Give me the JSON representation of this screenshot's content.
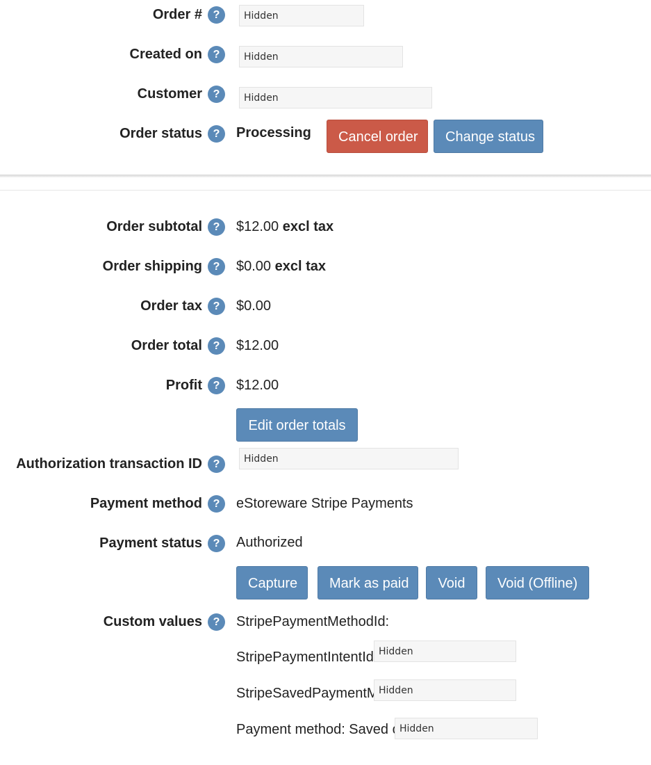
{
  "order": {
    "number_label": "Order #",
    "created_label": "Created on",
    "customer_label": "Customer",
    "status_label": "Order status",
    "status_value": "Processing",
    "cancel_button": "Cancel order",
    "change_status_button": "Change status"
  },
  "totals": {
    "subtotal_label": "Order subtotal",
    "subtotal_amount": "$12.00",
    "subtotal_suffix": "excl tax",
    "shipping_label": "Order shipping",
    "shipping_amount": "$0.00",
    "shipping_suffix": "excl tax",
    "tax_label": "Order tax",
    "tax_amount": "$0.00",
    "total_label": "Order total",
    "total_amount": "$12.00",
    "profit_label": "Profit",
    "profit_amount": "$12.00",
    "edit_button": "Edit order totals"
  },
  "payment": {
    "auth_label": "Authorization transaction ID",
    "method_label": "Payment method",
    "method_value": "eStoreware Stripe Payments",
    "status_label": "Payment status",
    "status_value": "Authorized",
    "capture_button": "Capture",
    "mark_paid_button": "Mark as paid",
    "void_button": "Void",
    "void_offline_button": "Void (Offline)"
  },
  "custom": {
    "label": "Custom values",
    "line1": "StripePaymentMethodId:",
    "line2": "StripePaymentIntentId",
    "line3": "StripeSavedPaymentMethod",
    "line4": "Payment method: Saved c"
  },
  "help_glyph": "?",
  "mask_text": "Hidden"
}
